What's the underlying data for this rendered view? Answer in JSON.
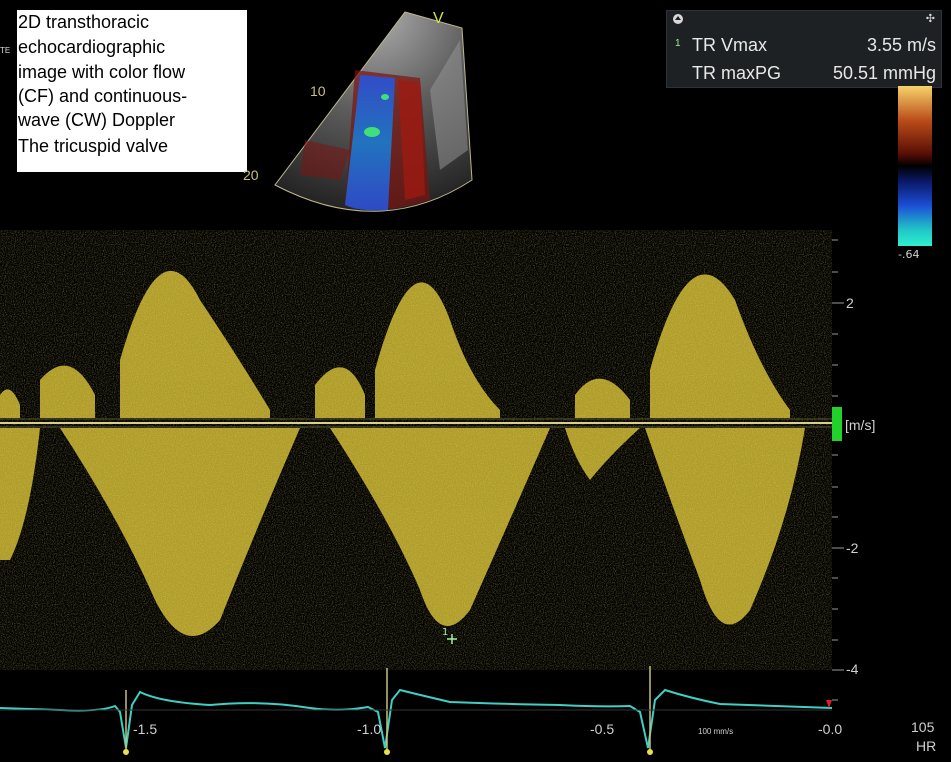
{
  "caption": {
    "lines": [
      "2D transthoracic",
      "echocardiographic",
      "image with color flow",
      "(CF) and continuous-",
      "wave (CW) Doppler",
      "The tricuspid valve"
    ],
    "side_tag": "TE"
  },
  "measurements": [
    {
      "index": "1",
      "name": "TR Vmax",
      "value": "3.55 m/s"
    },
    {
      "index": "",
      "name": "TR maxPG",
      "value": "50.51 mmHg"
    }
  ],
  "color_scale": {
    "low_label": "-.64"
  },
  "sector": {
    "view_marker": "V",
    "depth_labels": [
      "10",
      "20"
    ]
  },
  "velocity_axis": {
    "unit": "[m/s]",
    "ticks": [
      {
        "label": "2",
        "value": 2
      },
      {
        "label": "-2",
        "value": -2
      },
      {
        "label": "-4",
        "value": -4
      }
    ]
  },
  "time_axis": {
    "ticks": [
      {
        "label": "-1.5",
        "value": -1.5
      },
      {
        "label": "-1.0",
        "value": -1.0
      },
      {
        "label": "-0.5",
        "value": -0.5
      },
      {
        "label": "-0.0",
        "value": 0.0
      }
    ],
    "sweep_speed": "100 mm/s"
  },
  "heart_rate": {
    "value": "105",
    "label": "HR"
  },
  "cursor": {
    "index": "1",
    "symbol": "+"
  },
  "colors": {
    "doppler_signal": "#c8b636",
    "baseline": "#d8cf8a",
    "ecg_trace": "#3fcfc4",
    "zero_marker": "#22d22a",
    "view_marker": "#d6e04a"
  }
}
